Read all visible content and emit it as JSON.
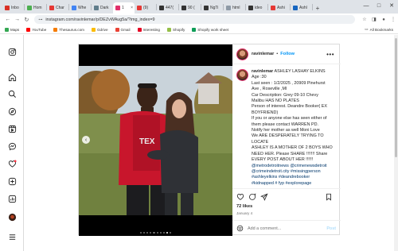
{
  "browser": {
    "tabs": [
      {
        "label": "Inbo",
        "color": "#d93025"
      },
      {
        "label": "Hom",
        "color": "#4caf50"
      },
      {
        "label": "Char",
        "color": "#e53935"
      },
      {
        "label": "Whe",
        "color": "#4285f4"
      },
      {
        "label": "Dark",
        "color": "#607d8b"
      },
      {
        "label": "1",
        "color": "#e1306c"
      },
      {
        "label": "(9)",
        "color": "#e53935"
      },
      {
        "label": "447(",
        "color": "#333333"
      },
      {
        "label": "90 (",
        "color": "#333333"
      },
      {
        "label": "NgTi",
        "color": "#333333"
      },
      {
        "label": "html",
        "color": "#8e9aa6"
      },
      {
        "label": "ideo",
        "color": "#333333"
      },
      {
        "label": "Ashi",
        "color": "#e53935"
      },
      {
        "label": "Ashl",
        "color": "#1565c0"
      }
    ],
    "new_tab_label": "+",
    "url": "instagram.com/ravinlemar/p/DEZvWAug5a/?img_index=9",
    "bookmarks": [
      {
        "label": "Maps",
        "color": "#34a853"
      },
      {
        "label": "YouTube",
        "color": "#ff0000"
      },
      {
        "label": "Thesaurus.com",
        "color": "#f57c00"
      },
      {
        "label": "Gdrive",
        "color": "#fbbc04"
      },
      {
        "label": "Gmail",
        "color": "#ea4335"
      },
      {
        "label": "Interesting",
        "color": "#e60023"
      },
      {
        "label": "Shopify",
        "color": "#95bf47"
      },
      {
        "label": "Shopify work sheet",
        "color": "#0f9d58"
      }
    ],
    "all_bookmarks_label": "All Bookmarks"
  },
  "post": {
    "username": "ravinlemar",
    "follow_label": "Follow",
    "more_label": "•••",
    "carousel_active_index": 9,
    "carousel_total": 10,
    "caption_lines": [
      "ravinlemar ASHLEY LASHAY ELKINS",
      "Age :30",
      "Last seen : 1/2/2025 , 20909 Pinehurst",
      "Ave , Roseville ,MI",
      "Car Description: Grey 09-10 Chevy",
      "Malibu HAS NO PLATES",
      "Person of interest. Deandre Booker( EX",
      "BOYFRIEND)",
      "If you or anyone else has seen either of",
      "them please contact WARREN PD.",
      "Notify her mother as well Moni Love",
      "We ARE DESPERATELY TRYING TO",
      "LOCATE",
      "ASHLEY IS A MOTHER OF 2 BOYS WHO",
      "NEED HER. Please SHARE !!!!!!! Share",
      "EVERY POST ABOUT HER !!!!!!"
    ],
    "tag_lines": [
      "@metrodetroitnews @crimenewsdetroit",
      "@crimeindetroit.city #missingperson",
      "#ashleyelkins #deandrebooker",
      "#kidnapped # fyp #explorepage"
    ],
    "likes": "72 likes",
    "date": "January 4",
    "comment_placeholder": "Add a comment...",
    "post_label": "Post"
  },
  "colors": {
    "accent": "#0095f6",
    "link": "#00376b",
    "border": "#dbdbdb"
  }
}
